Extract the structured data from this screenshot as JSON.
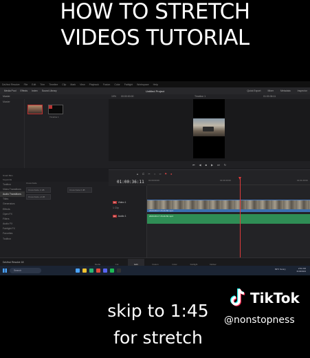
{
  "overlay": {
    "title_line1": "HOW TO STRETCH",
    "title_line2": "VIDEOS TUTORIAL",
    "caption_line1": "skip to 1:45",
    "caption_line2": "for stretch",
    "brand": "TikTok",
    "handle": "@nonstopness"
  },
  "app": {
    "menu": [
      "DaVinci Resolve",
      "File",
      "Edit",
      "Trim",
      "Timeline",
      "Clip",
      "Mark",
      "View",
      "Playback",
      "Fusion",
      "Color",
      "Fairlight",
      "Workspace",
      "Help"
    ],
    "toolbar": [
      "Media Pool",
      "Effects",
      "Index",
      "Sound Library"
    ],
    "project_title": "Untitled Project",
    "toolbar_right": [
      "Quick Export",
      "Mixer",
      "Metadata",
      "Inspector"
    ],
    "sub_left": "Master",
    "timeline_name": "Timeline 1",
    "zoom": "19%",
    "viewer_tc": "00:00:00:00",
    "timecode": "01:00:36:11",
    "smart_bins": [
      "Smart Bins",
      "Keywords",
      "Collections"
    ],
    "effects_list": [
      "Toolbox",
      "Video Transitions",
      "Audio Transitions",
      "Titles",
      "Generators",
      "Effects",
      "Open FX",
      "Filters",
      "Audio FX",
      "Fairlight FX",
      "Favorites",
      "Toolbox"
    ],
    "effects_header": "Cross Fade",
    "fx_items": [
      "Cross Fade -3 dB",
      "Cross Fade 0 dB",
      "Cross Fade +3 dB"
    ],
    "ruler": [
      "01:00:00:00",
      "01:00:40:00",
      "01:01:20:00"
    ],
    "track_v1": "Video 1",
    "track_a1": "Audio 1",
    "clip_name": "2023-06-17 15-40-50.mp4",
    "clip_count": "1 Clip",
    "pages": [
      "Media",
      "Cut",
      "Edit",
      "Fusion",
      "Color",
      "Fairlight",
      "Deliver"
    ],
    "active_page": "Edit",
    "resolve_label": "DaVinci Resolve 18",
    "taskbar": {
      "search": "Search",
      "weather": "89°F Sunny",
      "time": "2:51 PM",
      "date": "6/18/2023"
    }
  },
  "colors": {
    "accent_red": "#e23b3b",
    "video_clip": "#3a6fb0",
    "audio_clip": "#2f8d55",
    "tiktok_cyan": "#25f4ee",
    "tiktok_red": "#fe2c55"
  }
}
